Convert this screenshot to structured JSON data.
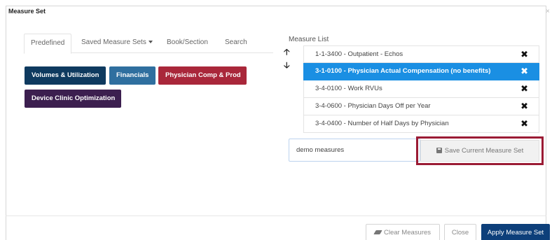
{
  "modal": {
    "title": "Measure Set",
    "close_glyph": "×"
  },
  "tabs": [
    {
      "label": "Predefined",
      "active": true
    },
    {
      "label": "Saved Measure Sets",
      "dropdown": true
    },
    {
      "label": "Book/Section"
    },
    {
      "label": "Search"
    }
  ],
  "categories": [
    {
      "label": "Volumes & Utilization",
      "color": "#0e3a5f"
    },
    {
      "label": "Financials",
      "color": "#2f6f9f"
    },
    {
      "label": "Physician Comp & Prod",
      "color": "#a9273a"
    },
    {
      "label": "Device Clinic Optimization",
      "color": "#3c1f4f"
    }
  ],
  "measure_list": {
    "label": "Measure List",
    "move_up_icon": "arrow-up-icon",
    "move_down_icon": "arrow-down-icon",
    "remove_icon": "remove-x-icon",
    "selected_color": "#1a8fe3",
    "items": [
      {
        "label": "1-1-3400 - Outpatient - Echos",
        "selected": false
      },
      {
        "label": "3-1-0100 - Physician Actual Compensation (no benefits)",
        "selected": true
      },
      {
        "label": "3-4-0100 - Work RVUs",
        "selected": false
      },
      {
        "label": "3-4-0600 - Physician Days Off per Year",
        "selected": false
      },
      {
        "label": "3-4-0400 - Number of Half Days by Physician",
        "selected": false
      }
    ]
  },
  "set_name": {
    "value": "demo measures"
  },
  "save_button": {
    "label": "Save Current Measure Set",
    "icon": "floppy-disk-icon"
  },
  "highlight_color": "#9b1b34",
  "footer": {
    "clear_label": "Clear Measures",
    "clear_icon": "eraser-icon",
    "close_label": "Close",
    "apply_label": "Apply Measure Set",
    "apply_color": "#0d3f7a"
  }
}
